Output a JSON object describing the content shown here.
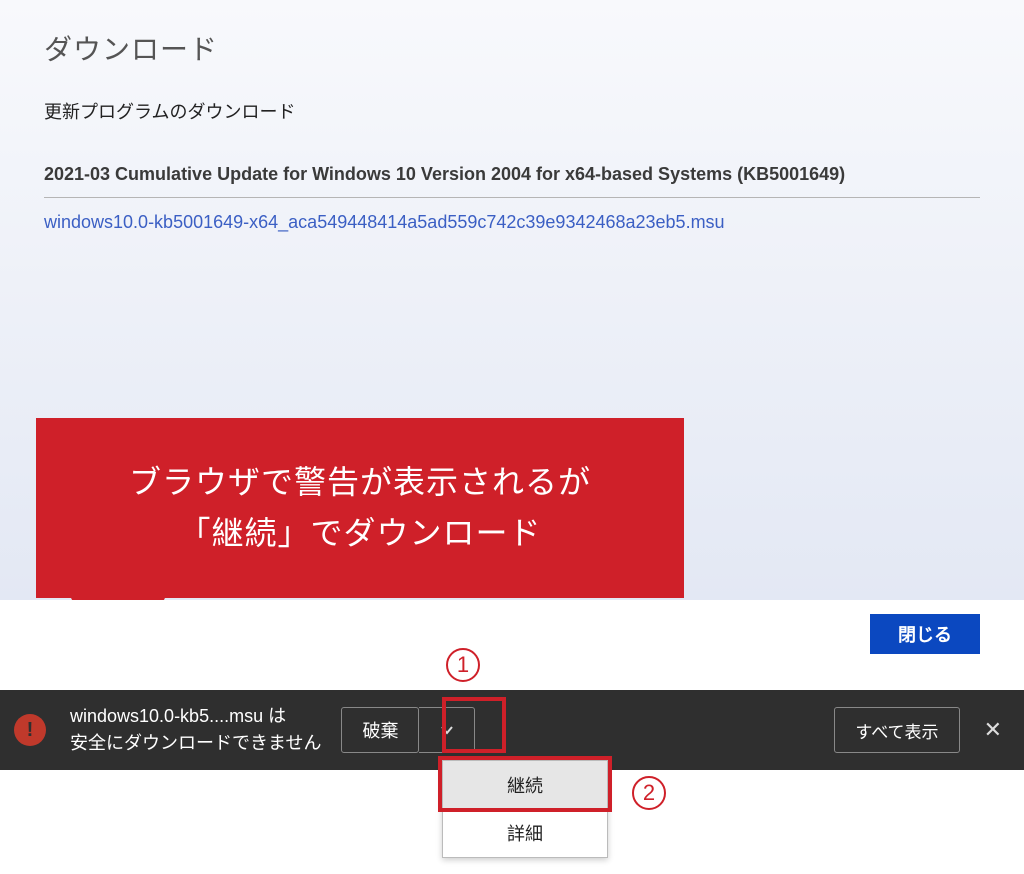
{
  "page": {
    "title": "ダウンロード",
    "subtitle": "更新プログラムのダウンロード",
    "update_name": "2021-03 Cumulative Update for Windows 10 Version 2004 for x64-based Systems (KB5001649)",
    "download_link": "windows10.0-kb5001649-x64_aca549448414a5ad559c742c39e9342468a23eb5.msu",
    "close_button": "閉じる"
  },
  "callout": {
    "line1": "ブラウザで警告が表示されるが",
    "line2": "「継続」でダウンロード"
  },
  "steps": {
    "one": "1",
    "two": "2"
  },
  "download_bar": {
    "file_line": "windows10.0-kb5....msu は",
    "warn_line": "安全にダウンロードできません",
    "discard": "破棄",
    "show_all": "すべて表示",
    "close_x": "✕"
  },
  "dropdown": {
    "continue": "継続",
    "details": "詳細"
  }
}
